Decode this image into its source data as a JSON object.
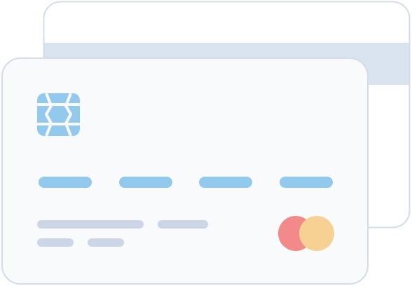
{
  "illustration": {
    "subject": "credit-card-stack",
    "colors": {
      "card_fill": "#f9fafc",
      "card_outline": "#d3dce9",
      "back_card_fill": "#ffffff",
      "magnetic_stripe": "#dae4f0",
      "chip": "#93c9ed",
      "card_number": "#93c9ed",
      "text_placeholder": "#ccd6e6",
      "brand_circle_left": "#f28a89",
      "brand_circle_right": "#f7d094"
    },
    "icons": {
      "chip": "chip-icon",
      "brand": "card-brand-logo-icon"
    },
    "card_number_groups": 4,
    "text_placeholder_lines": 2
  }
}
